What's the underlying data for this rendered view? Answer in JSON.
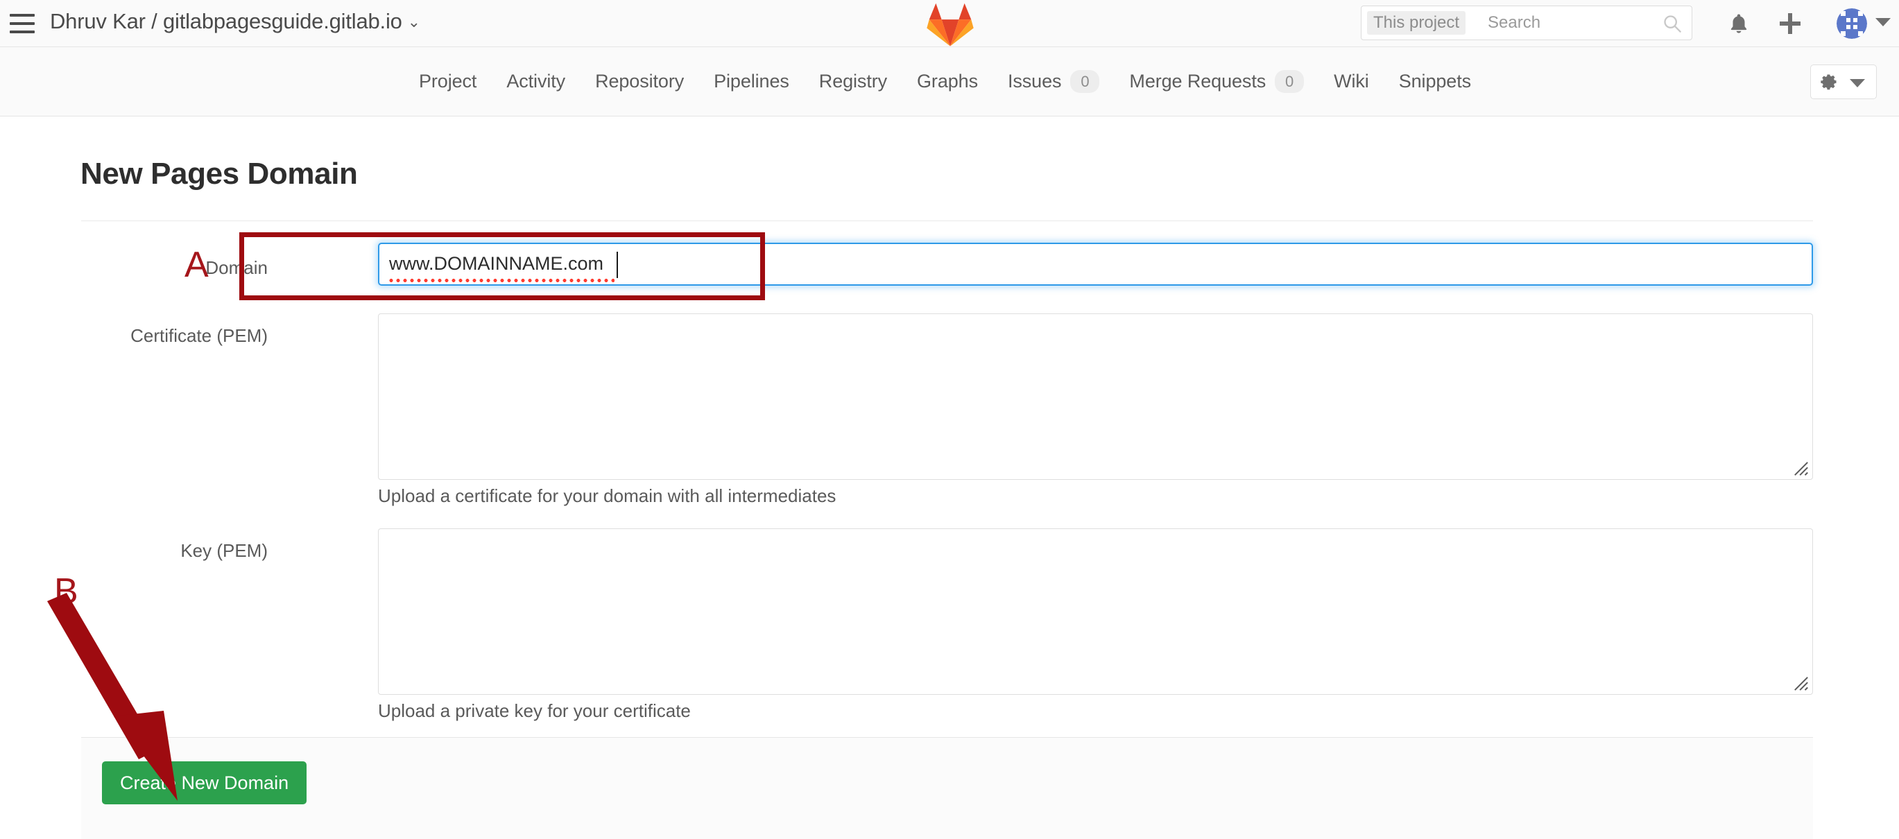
{
  "header": {
    "menu_icon": "hamburger-icon",
    "breadcrumb": "Dhruv Kar / gitlabpagesguide.gitlab.io",
    "breadcrumb_caret": "⌄",
    "logo": "gitlab-tanuki-logo",
    "search": {
      "scope": "This project",
      "placeholder": "Search",
      "value": "",
      "icon": "search-icon"
    },
    "notifications_icon": "bell-icon",
    "new_icon": "plus-icon",
    "avatar": "user-avatar-identicon",
    "avatar_caret": "chevron-down-icon"
  },
  "nav": {
    "items": [
      {
        "label": "Project",
        "badge": null
      },
      {
        "label": "Activity",
        "badge": null
      },
      {
        "label": "Repository",
        "badge": null
      },
      {
        "label": "Pipelines",
        "badge": null
      },
      {
        "label": "Registry",
        "badge": null
      },
      {
        "label": "Graphs",
        "badge": null
      },
      {
        "label": "Issues",
        "badge": "0"
      },
      {
        "label": "Merge Requests",
        "badge": "0"
      },
      {
        "label": "Wiki",
        "badge": null
      },
      {
        "label": "Snippets",
        "badge": null
      }
    ],
    "settings_icon": "gear-icon",
    "settings_caret": "chevron-down-icon"
  },
  "page": {
    "title": "New Pages Domain"
  },
  "form": {
    "domain": {
      "label": "Domain",
      "value": "www.DOMAINNAME.com",
      "placeholder": ""
    },
    "certificate": {
      "label": "Certificate (PEM)",
      "value": "",
      "help": "Upload a certificate for your domain with all intermediates"
    },
    "key": {
      "label": "Key (PEM)",
      "value": "",
      "help": "Upload a private key for your certificate"
    },
    "submit_label": "Create New Domain"
  },
  "annotations": {
    "a_label": "A",
    "b_label": "B",
    "box_color": "#9e0b10",
    "letter_color": "#a5161b",
    "arrow_color": "#9e0b10"
  },
  "colors": {
    "accent_green": "#2ca14d",
    "focus_blue": "#2f9ae8",
    "annotation_red": "#9e0b10",
    "header_bg": "#fafafa"
  }
}
